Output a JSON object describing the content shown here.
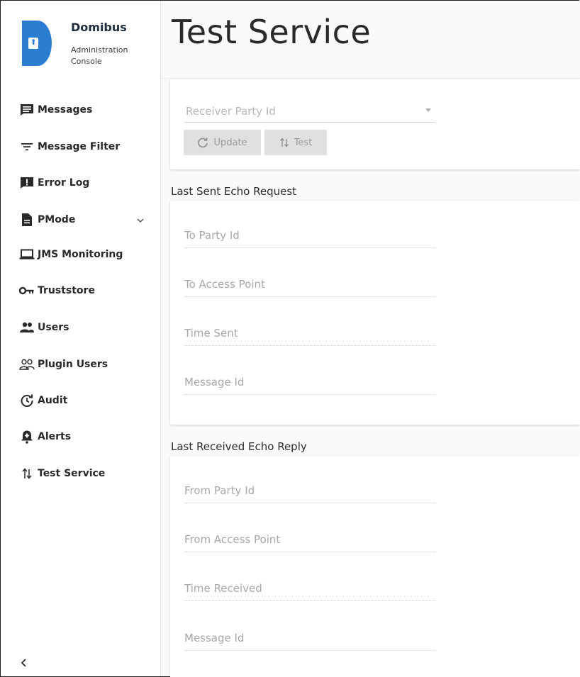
{
  "app": {
    "name": "Domibus",
    "subtitle_line1": "Administration",
    "subtitle_line2": "Console",
    "accent_color": "#2a7dd1"
  },
  "sidebar": {
    "items": [
      {
        "label": "Messages",
        "icon": "message-icon"
      },
      {
        "label": "Message Filter",
        "icon": "filter-icon"
      },
      {
        "label": "Error Log",
        "icon": "error-log-icon"
      },
      {
        "label": "PMode",
        "icon": "document-icon",
        "has_submenu": true
      },
      {
        "label": "JMS Monitoring",
        "icon": "laptop-icon"
      },
      {
        "label": "Truststore",
        "icon": "key-icon"
      },
      {
        "label": "Users",
        "icon": "users-icon"
      },
      {
        "label": "Plugin Users",
        "icon": "plugin-users-icon"
      },
      {
        "label": "Audit",
        "icon": "audit-icon"
      },
      {
        "label": "Alerts",
        "icon": "alert-icon"
      },
      {
        "label": "Test Service",
        "icon": "swap-arrows-icon"
      }
    ],
    "collapse_icon": "chevron-left-icon"
  },
  "page": {
    "title": "Test Service"
  },
  "controls": {
    "receiver_placeholder": "Receiver Party Id",
    "update_label": "Update",
    "test_label": "Test"
  },
  "sent": {
    "heading": "Last Sent Echo Request",
    "fields": [
      "To Party Id",
      "To Access Point",
      "Time Sent",
      "Message Id"
    ]
  },
  "received": {
    "heading": "Last Received Echo Reply",
    "fields": [
      "From Party Id",
      "From Access Point",
      "Time Received",
      "Message Id"
    ]
  }
}
